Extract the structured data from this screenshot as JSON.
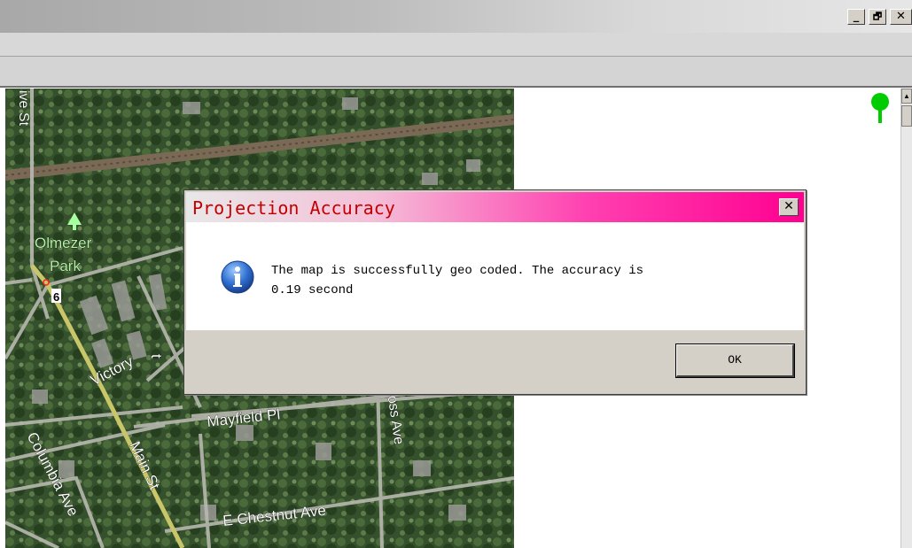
{
  "window": {
    "controls": {
      "minimize": "_",
      "restore": "🗗",
      "close": "✕"
    }
  },
  "map": {
    "labels": {
      "olive_st": "ive St",
      "olmezer": "Olmezer",
      "park": "Park",
      "route": "6",
      "victory": "Victory",
      "mayfield": "Mayfield Pl",
      "ross": "Ross Ave",
      "columbia": "Columbia Ave",
      "main": "Main St",
      "chestnut": "E Chestnut Ave",
      "partial_st": "t"
    },
    "pin_color": "#00cc00"
  },
  "dialog": {
    "title": "Projection Accuracy",
    "close_label": "✕",
    "message_line1": "The map is successfully geo coded. The accuracy is",
    "message_line2": "0.19 second",
    "ok_label": "OK",
    "icon": "info-icon",
    "title_color": "#c40000",
    "accent": "#ff0090"
  }
}
